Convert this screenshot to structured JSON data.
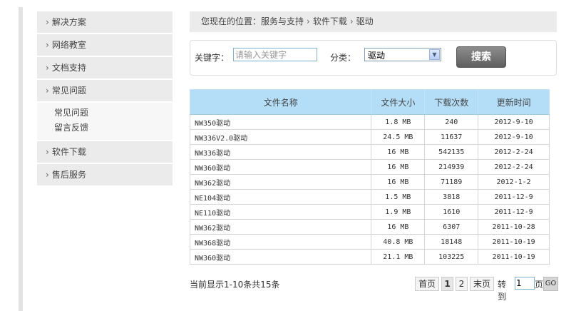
{
  "sidebar": {
    "items": [
      {
        "label": "解决方案"
      },
      {
        "label": "网络教室"
      },
      {
        "label": "文档支持"
      },
      {
        "label": "常见问题"
      },
      {
        "label": "软件下载"
      },
      {
        "label": "售后服务"
      }
    ],
    "arrow": "›",
    "subitems": [
      {
        "label": "常见问题"
      },
      {
        "label": "留言反馈"
      }
    ]
  },
  "breadcrumb": {
    "prefix": "您现在的位置：",
    "items": [
      "服务与支持",
      "软件下载",
      "驱动"
    ],
    "separator": "›"
  },
  "search": {
    "keyword_label": "关键字：",
    "keyword_placeholder": "请输入关键字",
    "keyword_value": "",
    "category_label": "分类：",
    "category_value": "驱动",
    "button_label": "搜索"
  },
  "table": {
    "headers": [
      "文件名称",
      "文件大小",
      "下载次数",
      "更新时间"
    ],
    "rows": [
      [
        "NW350驱动",
        "1.8 MB",
        "240",
        "2012-9-10"
      ],
      [
        "NW336V2.0驱动",
        "24.5 MB",
        "11637",
        "2012-9-10"
      ],
      [
        "NW336驱动",
        "16 MB",
        "542135",
        "2012-2-24"
      ],
      [
        "NW360驱动",
        "16 MB",
        "214939",
        "2012-2-24"
      ],
      [
        "NW362驱动",
        "16 MB",
        "71189",
        "2012-1-2"
      ],
      [
        "NE104驱动",
        "1.5 MB",
        "3818",
        "2011-12-9"
      ],
      [
        "NE110驱动",
        "1.9 MB",
        "1610",
        "2011-12-9"
      ],
      [
        "NW362驱动",
        "16 MB",
        "6307",
        "2011-10-28"
      ],
      [
        "NW368驱动",
        "40.8 MB",
        "18148",
        "2011-10-19"
      ],
      [
        "NW360驱动",
        "21.1 MB",
        "103225",
        "2011-10-19"
      ]
    ]
  },
  "pagination": {
    "summary": "当前显示1-10条共15条",
    "first": "首页",
    "pages": [
      "1",
      "2"
    ],
    "current_page": "1",
    "last": "末页",
    "goto_label": "转到",
    "goto_value": "1",
    "page_suffix": "页",
    "go_label": "GO"
  },
  "colors": {
    "header_bg": "#b4def7",
    "sidebar_bg": "#ebebeb",
    "search_button": "#6e6e6e"
  }
}
